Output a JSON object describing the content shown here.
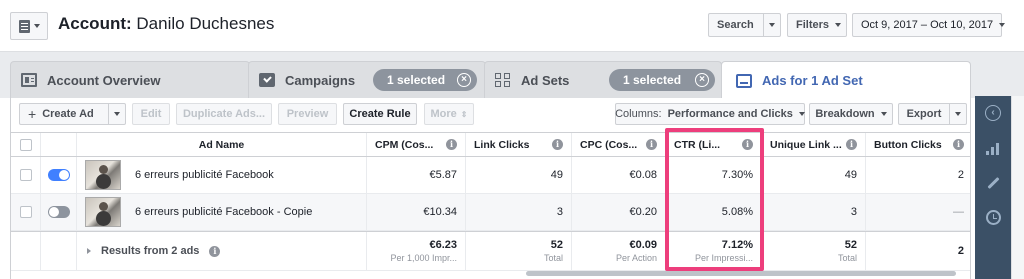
{
  "header": {
    "account_label": "Account:",
    "account_name": "Danilo Duchesnes",
    "search_label": "Search",
    "filters_label": "Filters",
    "date_range": "Oct 9, 2017 – Oct 10, 2017"
  },
  "tabs": [
    {
      "label": "Account Overview",
      "icon": "account-overview-icon"
    },
    {
      "label": "Campaigns",
      "icon": "checkbox-icon",
      "selected_badge": "1 selected"
    },
    {
      "label": "Ad Sets",
      "icon": "grid-icon",
      "selected_badge": "1 selected"
    },
    {
      "label": "Ads for 1 Ad Set",
      "icon": "ad-icon",
      "active": true
    }
  ],
  "toolbar": {
    "create_ad": "Create Ad",
    "edit": "Edit",
    "duplicate": "Duplicate Ads...",
    "preview": "Preview",
    "create_rule": "Create Rule",
    "more": "More",
    "columns_prefix": "Columns:",
    "columns_value": "Performance and Clicks",
    "breakdown": "Breakdown",
    "export": "Export"
  },
  "table": {
    "columns": [
      "Ad Name",
      "CPM (Cos...",
      "Link Clicks",
      "CPC (Cos...",
      "CTR (Li...",
      "Unique Link ...",
      "Button Clicks"
    ],
    "rows": [
      {
        "name": "6 erreurs publicité Facebook",
        "enabled": true,
        "cpm": "€5.87",
        "link_clicks": "49",
        "cpc": "€0.08",
        "ctr": "7.30%",
        "unique_link": "49",
        "button_clicks": "2"
      },
      {
        "name": "6 erreurs publicité Facebook - Copie",
        "enabled": false,
        "cpm": "€10.34",
        "link_clicks": "3",
        "cpc": "€0.20",
        "ctr": "5.08%",
        "unique_link": "3",
        "button_clicks": "—"
      }
    ],
    "summary": {
      "label": "Results from 2 ads",
      "cpm": "€6.23",
      "cpm_sub": "Per 1,000 Impr...",
      "link_clicks": "52",
      "link_clicks_sub": "Total",
      "cpc": "€0.09",
      "cpc_sub": "Per Action",
      "ctr": "7.12%",
      "ctr_sub": "Per Impressi...",
      "unique_link": "52",
      "unique_link_sub": "Total",
      "button_clicks": "2"
    }
  },
  "colors": {
    "accent": "#4267b2",
    "highlight": "#ed3e7c",
    "toggle_on": "#4080ff",
    "rail": "#3b5066"
  }
}
